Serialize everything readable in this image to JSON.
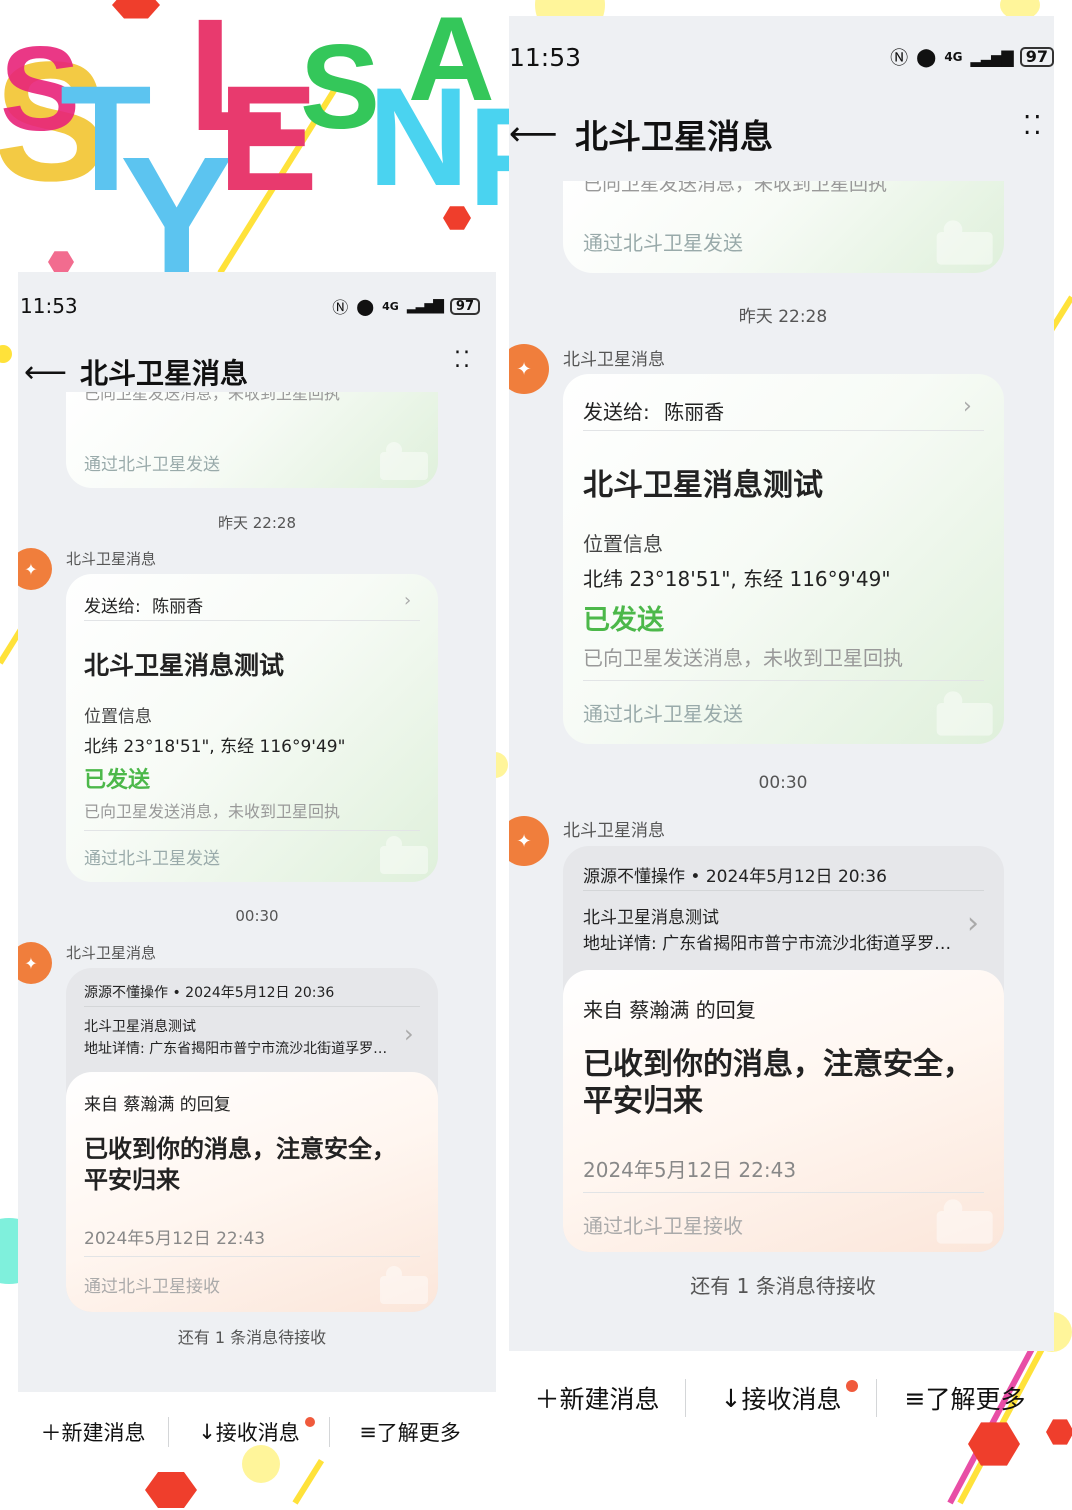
{
  "logo": {
    "letters": [
      "S",
      "T",
      "Y",
      "L",
      "E",
      "S",
      "N",
      "A",
      "P"
    ]
  },
  "status": {
    "time": "11:53",
    "network": "4G",
    "battery": "97"
  },
  "header": {
    "back_icon": "arrow-left-icon",
    "title": "北斗卫星消息",
    "more_icon": "more-dots-icon"
  },
  "prev_card": {
    "cut_text": "已向卫星发送消息，未收到卫星回执",
    "via": "通过北斗卫星发送"
  },
  "ts1": "昨天 22:28",
  "sender_label": "北斗卫星消息",
  "msg1": {
    "to_label": "发送给:",
    "to_name": "陈丽香",
    "title": "北斗卫星消息测试",
    "loc_label": "位置信息",
    "coords": "北纬 23°18'51\", 东经 116°9'49\"",
    "status": "已发送",
    "note": "已向卫星发送消息，未收到卫星回执",
    "via": "通过北斗卫星发送"
  },
  "ts2": "00:30",
  "msg2": {
    "quote_head": "源源不懂操作 • 2024年5月12日 20:36",
    "quote_title": "北斗卫星消息测试",
    "quote_addr": "地址详情: 广东省揭阳市普宁市流沙北街道孚罗…",
    "reply_from": "来自 蔡瀚满 的回复",
    "reply_text": "已收到你的消息，注意安全，平安归来",
    "reply_time": "2024年5月12日 22:43",
    "via": "通过北斗卫星接收"
  },
  "pending": "还有 1 条消息待接收",
  "bottom": {
    "new": "新建消息",
    "receive": "接收消息",
    "more": "了解更多",
    "new_icon": "plus-icon",
    "receive_icon": "arrow-down-icon",
    "more_icon": "menu-icon"
  },
  "colors": {
    "green_status": "#4cb84a",
    "avatar": "#f07e3c",
    "notify_dot": "#f05a3c"
  }
}
